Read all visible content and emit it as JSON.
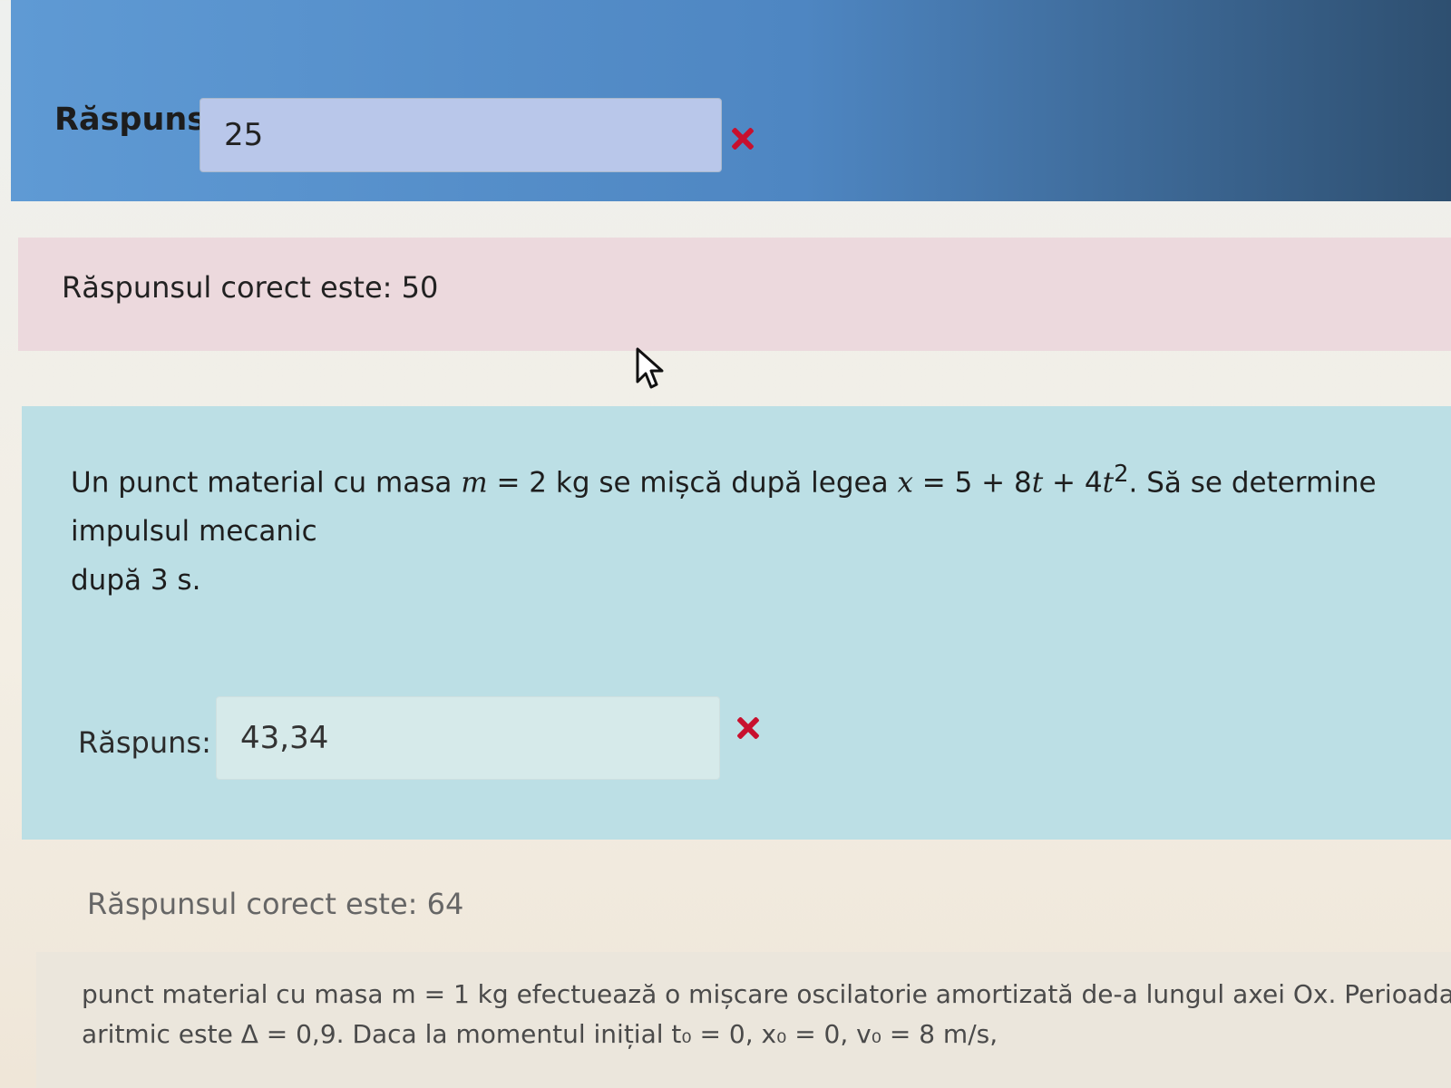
{
  "answer_block_1": {
    "label": "Răspuns:",
    "input_value": "25",
    "status_icon": "x-mark-icon"
  },
  "feedback_1": {
    "text": "Răspunsul corect este: 50"
  },
  "question_2": {
    "line1_prefix": "Un punct material cu masa ",
    "var_m": "m",
    "mass_equals": " = 2 kg se mișcă după legea ",
    "var_x": "x",
    "law_part1": " = 5 + 8",
    "var_t1": "t",
    "law_part2": " + 4",
    "var_t2": "t",
    "exponent": "2",
    "line1_suffix": ". Să se determine impulsul mecanic",
    "line2": "după 3 s.",
    "answer_label": "Răspuns:",
    "input_value": "43,34",
    "status_icon": "x-mark-icon"
  },
  "feedback_2": {
    "text": "Răspunsul corect este: 64"
  },
  "question_3": {
    "line1": "punct material cu masa m = 1 kg efectuează o mișcare oscilatorie amortizată de-a lungul axei Ox. Perioada",
    "line2": "aritmic este Δ = 0,9. Daca la momentul inițial t₀ = 0, x₀ = 0, v₀ = 8 m/s,"
  },
  "colors": {
    "answer_block_bg": "#5f9ad4",
    "feedback_bg": "#ecd9dd",
    "question_bg": "#bcdfe5",
    "error_red": "#c8102e"
  }
}
